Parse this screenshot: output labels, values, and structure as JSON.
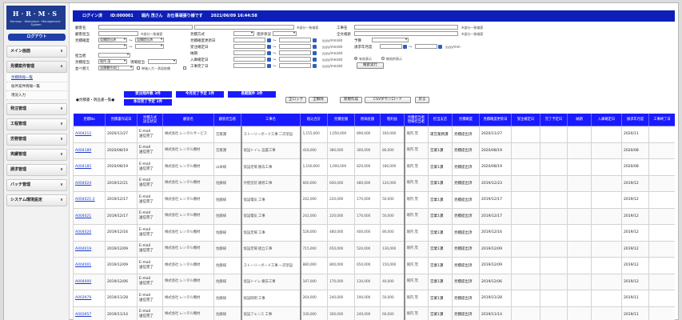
{
  "sidebar": {
    "logo": {
      "title": "H·R·M·S",
      "subtitle": "Harrison · Workplace · Management · System"
    },
    "logout_label": "ログアウト",
    "menu": [
      {
        "label": "メイン画面"
      },
      {
        "label": "見積案件管理",
        "active": true,
        "sub": [
          "見積情報一覧",
          "枝件案件情報一覧",
          "現況入力"
        ]
      },
      {
        "label": "発注管理"
      },
      {
        "label": "工程管理"
      },
      {
        "label": "労務管理"
      },
      {
        "label": "実績管理"
      },
      {
        "label": "請求管理"
      },
      {
        "label": "バッチ管理"
      },
      {
        "label": "システム環境設定"
      }
    ]
  },
  "header": {
    "text": "ログイン済　　ID:000001　　堀内 茂さん　お仕事頑張り様です　　2021/06/09 16:44:58"
  },
  "form": {
    "labels": {
      "customer": "顧客名",
      "customer_staff": "顧客担当",
      "est_status": "見積確度",
      "staff": "担当者",
      "est_staff": "見積担当",
      "sort": "並べ替え",
      "est_method": "見積方式",
      "est_update": "見積確度更新日",
      "est_date": "受注確定日",
      "deadline": "納期",
      "arrival": "入庫確定日",
      "finish": "工事完了日",
      "project": "工事名",
      "fulltext": "全文検索",
      "budget": "予算",
      "billing_month": "請求年月度",
      "progress": "進捗状況",
      "status_col": "現場担当",
      "enterer": "入力者",
      "active_only": "有効表示",
      "all_show": "無効併表示"
    },
    "notes": {
      "partial_match": "※部分一致検索",
      "ymd": "yyyy/mm/dd",
      "ym": "yyyy/mm",
      "single_entry": "単価入力・承認依頼"
    },
    "selects": {
      "est_status_1": "見積提出済",
      "est_status_2": "見積提出済",
      "est_staff_val": "堀内 茂",
      "sort_val": "見積書作成日"
    },
    "search_button": "検索実行"
  },
  "tiles": [
    {
      "label": "受注残件数 3件"
    },
    {
      "label": "今月完了予定 1件"
    },
    {
      "label": "長期案件 2件"
    },
    {
      "label": "本日完了予定 1件"
    }
  ],
  "list_title": "●見積書・明品書一覧●",
  "actions": [
    "全ロック",
    "全解除",
    "新規作成",
    "CSVダウンロード",
    "戻る"
  ],
  "table": {
    "columns": [
      "見積No",
      "見積書作成日",
      "見積方式\n送信状況",
      "顧客名",
      "顧客担当者",
      "工事名",
      "税込合計",
      "見積金額",
      "原価金額",
      "粗利益",
      "見積担当者\n現場担当者",
      "担当支店",
      "見積確度",
      "見積確度更新日",
      "受注確定日",
      "完了予定日",
      "納期",
      "入庫確定日",
      "請求年月度",
      "工事終了日"
    ],
    "rows": [
      {
        "no": "A004212",
        "date": "2020/11/27",
        "method": "E-mail\n送信完了",
        "customer": "株式会社 レンタルサービス",
        "cstaff": "営業課",
        "project": "ストーリーボード工事 二次架設",
        "total": "1,155,000",
        "amount": "1,050,000",
        "cost": "890,000",
        "profit": "160,000",
        "staff": "堀内 茂",
        "branch": "運営業務課",
        "status": "見積提出済",
        "upd": "2020/11/27",
        "order": "",
        "plan": "",
        "due": "",
        "arrival": "",
        "bill": "2020/11",
        "end": ""
      },
      {
        "no": "A004189",
        "date": "2020/08/19",
        "method": "E-mail\n送信完了",
        "customer": "株式会社 レンタル機材",
        "cstaff": "営業課",
        "project": "仮設トイレ 設置工事",
        "total": "418,000",
        "amount": "380,000",
        "cost": "300,000",
        "profit": "80,000",
        "staff": "堀内 茂",
        "branch": "営業1課",
        "status": "見積提出済",
        "upd": "2020/08/19",
        "order": "",
        "plan": "",
        "due": "",
        "arrival": "",
        "bill": "2020/08",
        "end": ""
      },
      {
        "no": "A004185",
        "date": "2020/08/19",
        "method": "E-mail\n送信完了",
        "customer": "株式会社 レンタル機材",
        "cstaff": "山本様",
        "project": "仮設足場 撤去工事",
        "total": "1,100,000",
        "amount": "1,000,000",
        "cost": "820,000",
        "profit": "180,000",
        "staff": "堀内 茂",
        "branch": "営業1課",
        "status": "見積提出済",
        "upd": "2020/08/19",
        "order": "",
        "plan": "",
        "due": "",
        "arrival": "",
        "bill": "2020/08",
        "end": ""
      },
      {
        "no": "A004024",
        "date": "2019/12/21",
        "method": "E-mail\n送信完了",
        "customer": "株式会社 レンタル機材",
        "cstaff": "佐藤様",
        "project": "外壁塗装 補修工事",
        "total": "660,000",
        "amount": "600,000",
        "cost": "480,000",
        "profit": "120,000",
        "staff": "堀内 茂",
        "branch": "営業1課",
        "status": "見積提出済",
        "upd": "2019/12/23",
        "order": "",
        "plan": "",
        "due": "",
        "arrival": "",
        "bill": "2019/12",
        "end": ""
      },
      {
        "no": "A004021-2",
        "date": "2019/12/17",
        "method": "E-mail\n送信完了",
        "customer": "株式会社 レンタル機材",
        "cstaff": "佐藤様",
        "project": "仮設電気 工事",
        "total": "242,000",
        "amount": "220,000",
        "cost": "170,000",
        "profit": "50,000",
        "staff": "堀内 茂",
        "branch": "営業1課",
        "status": "見積提出済",
        "upd": "2019/12/17",
        "order": "",
        "plan": "",
        "due": "",
        "arrival": "",
        "bill": "2019/12",
        "end": ""
      },
      {
        "no": "A004021",
        "date": "2019/12/17",
        "method": "E-mail\n送信完了",
        "customer": "株式会社 レンタル機材",
        "cstaff": "佐藤様",
        "project": "仮設電気 工事",
        "total": "242,000",
        "amount": "220,000",
        "cost": "170,000",
        "profit": "50,000",
        "staff": "堀内 茂",
        "branch": "営業1課",
        "status": "見積提出済",
        "upd": "2019/12/17",
        "order": "",
        "plan": "",
        "due": "",
        "arrival": "",
        "bill": "2019/12",
        "end": ""
      },
      {
        "no": "A004020",
        "date": "2019/12/16",
        "method": "E-mail\n送信完了",
        "customer": "株式会社 レンタル機材",
        "cstaff": "佐藤様",
        "project": "仮設足場 工事",
        "total": "528,000",
        "amount": "480,000",
        "cost": "400,000",
        "profit": "80,000",
        "staff": "堀内 茂",
        "branch": "営業1課",
        "status": "見積提出済",
        "upd": "2019/12/16",
        "order": "",
        "plan": "",
        "due": "",
        "arrival": "",
        "bill": "2019/12",
        "end": ""
      },
      {
        "no": "A004019",
        "date": "2019/12/09",
        "method": "E-mail\n送信完了",
        "customer": "株式会社 レンタル機材",
        "cstaff": "佐藤様",
        "project": "仮設足場 組立工事",
        "total": "715,000",
        "amount": "650,000",
        "cost": "520,000",
        "profit": "130,000",
        "staff": "堀内 茂",
        "branch": "営業1課",
        "status": "見積提出済",
        "upd": "2019/12/09",
        "order": "",
        "plan": "",
        "due": "",
        "arrival": "",
        "bill": "2019/12",
        "end": ""
      },
      {
        "no": "A004001",
        "date": "2019/12/09",
        "method": "E-mail\n送信完了",
        "customer": "株式会社 レンタル機材",
        "cstaff": "佐藤様",
        "project": "ストーリーボード工事 一次架設",
        "total": "880,000",
        "amount": "800,000",
        "cost": "650,000",
        "profit": "150,000",
        "staff": "堀内 茂",
        "branch": "営業1課",
        "status": "見積提出済",
        "upd": "2019/12/09",
        "order": "",
        "plan": "",
        "due": "",
        "arrival": "",
        "bill": "2019/12",
        "end": ""
      },
      {
        "no": "A004000",
        "date": "2019/12/06",
        "method": "E-mail\n送信完了",
        "customer": "株式会社 レンタル機材",
        "cstaff": "佐藤様",
        "project": "仮設トイレ 撤去工事",
        "total": "187,000",
        "amount": "170,000",
        "cost": "130,000",
        "profit": "40,000",
        "staff": "堀内 茂",
        "branch": "営業1課",
        "status": "見積提出済",
        "upd": "2019/12/06",
        "order": "",
        "plan": "",
        "due": "",
        "arrival": "",
        "bill": "2019/12",
        "end": ""
      },
      {
        "no": "A003979",
        "date": "2019/11/28",
        "method": "E-mail\n送信完了",
        "customer": "株式会社 レンタル機材",
        "cstaff": "佐藤様",
        "project": "仮設照明 工事",
        "total": "264,000",
        "amount": "240,000",
        "cost": "190,000",
        "profit": "50,000",
        "staff": "堀内 茂",
        "branch": "営業1課",
        "status": "見積提出済",
        "upd": "2019/11/28",
        "order": "",
        "plan": "",
        "due": "",
        "arrival": "",
        "bill": "2019/11",
        "end": ""
      },
      {
        "no": "A003957",
        "date": "2019/11/14",
        "method": "E-mail\n送信完了",
        "customer": "株式会社 レンタル機材",
        "cstaff": "佐藤様",
        "project": "仮設フェンス 工事",
        "total": "330,000",
        "amount": "300,000",
        "cost": "240,000",
        "profit": "60,000",
        "staff": "堀内 茂",
        "branch": "営業1課",
        "status": "見積提出済",
        "upd": "2019/11/14",
        "order": "",
        "plan": "",
        "due": "",
        "arrival": "",
        "bill": "2019/11",
        "end": ""
      }
    ]
  }
}
